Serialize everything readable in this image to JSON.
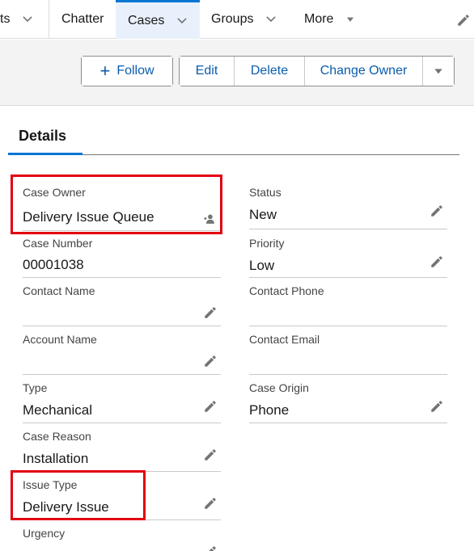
{
  "nav": {
    "items": [
      {
        "label": "ts"
      },
      {
        "label": "Chatter"
      },
      {
        "label": "Cases"
      },
      {
        "label": "Groups"
      },
      {
        "label": "More"
      }
    ]
  },
  "actions": {
    "follow": "Follow",
    "edit": "Edit",
    "delete": "Delete",
    "change_owner": "Change Owner"
  },
  "tabs": {
    "details": "Details"
  },
  "fields": {
    "case_owner": {
      "label": "Case Owner",
      "value": "Delivery Issue Queue"
    },
    "status": {
      "label": "Status",
      "value": "New"
    },
    "case_number": {
      "label": "Case Number",
      "value": "00001038"
    },
    "priority": {
      "label": "Priority",
      "value": "Low"
    },
    "contact_name": {
      "label": "Contact Name",
      "value": ""
    },
    "contact_phone": {
      "label": "Contact Phone",
      "value": ""
    },
    "account_name": {
      "label": "Account Name",
      "value": ""
    },
    "contact_email": {
      "label": "Contact Email",
      "value": ""
    },
    "type": {
      "label": "Type",
      "value": "Mechanical"
    },
    "case_origin": {
      "label": "Case Origin",
      "value": "Phone"
    },
    "case_reason": {
      "label": "Case Reason",
      "value": "Installation"
    },
    "issue_type": {
      "label": "Issue Type",
      "value": "Delivery Issue"
    },
    "urgency": {
      "label": "Urgency",
      "value": ""
    }
  },
  "colors": {
    "brand_blue": "#0176d3",
    "link_blue": "#0b5cab",
    "highlight_red": "#e3000f"
  },
  "icons": {
    "edit": "pencil-icon",
    "owner": "change-owner-icon",
    "chevron": "chevron-down-icon"
  }
}
